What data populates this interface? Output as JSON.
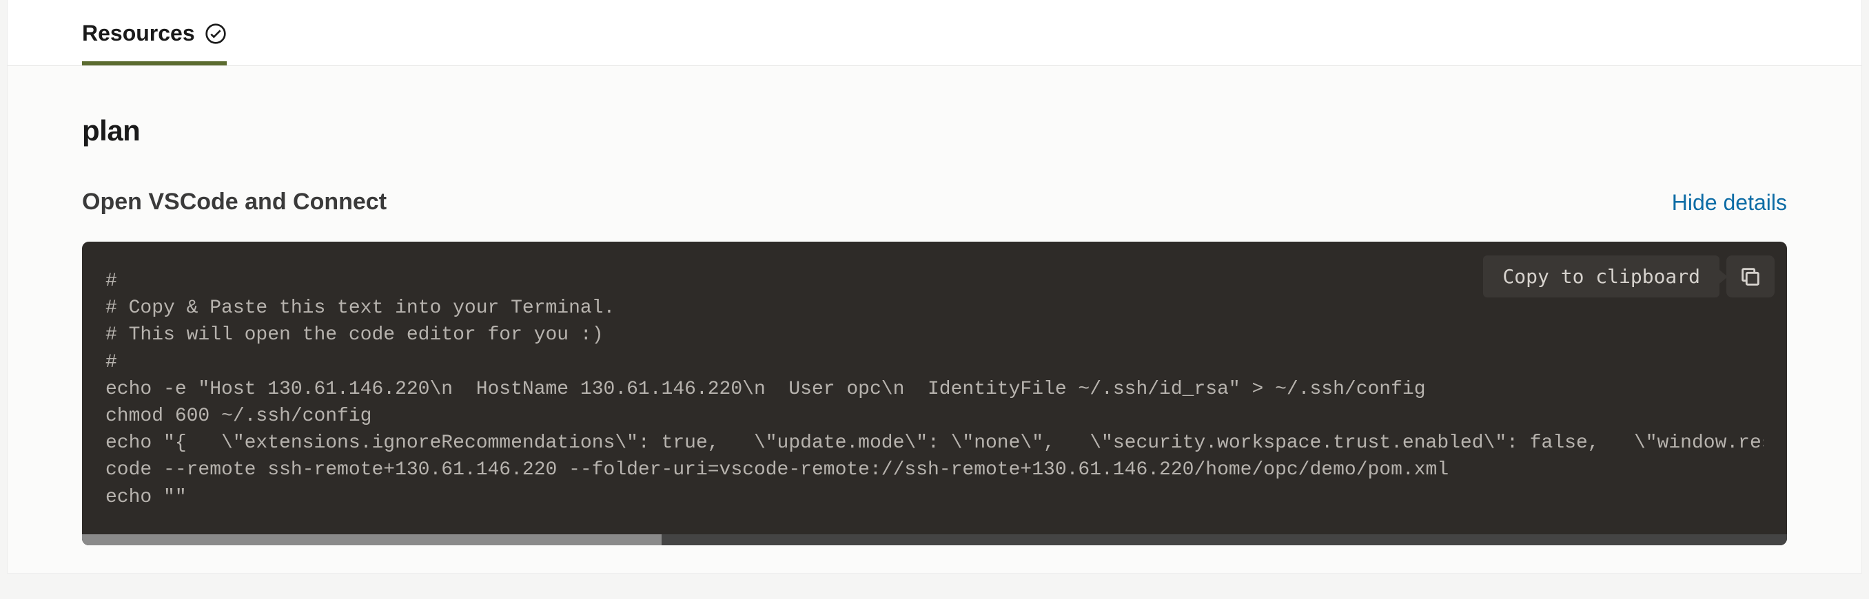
{
  "tab": {
    "label": "Resources"
  },
  "heading": "plan",
  "subtitle": "Open VSCode and Connect",
  "hide_details": "Hide details",
  "copy": {
    "tooltip": "Copy to clipboard"
  },
  "code": "#\n# Copy & Paste this text into your Terminal.\n# This will open the code editor for you :)\n#\necho -e \"Host 130.61.146.220\\n  HostName 130.61.146.220\\n  User opc\\n  IdentityFile ~/.ssh/id_rsa\" > ~/.ssh/config\nchmod 600 ~/.ssh/config\necho \"{   \\\"extensions.ignoreRecommendations\\\": true,   \\\"update.mode\\\": \\\"none\\\",   \\\"security.workspace.trust.enabled\\\": false,   \\\"window.restoreFu\ncode --remote ssh-remote+130.61.146.220 --folder-uri=vscode-remote://ssh-remote+130.61.146.220/home/opc/demo/pom.xml\necho \"\""
}
